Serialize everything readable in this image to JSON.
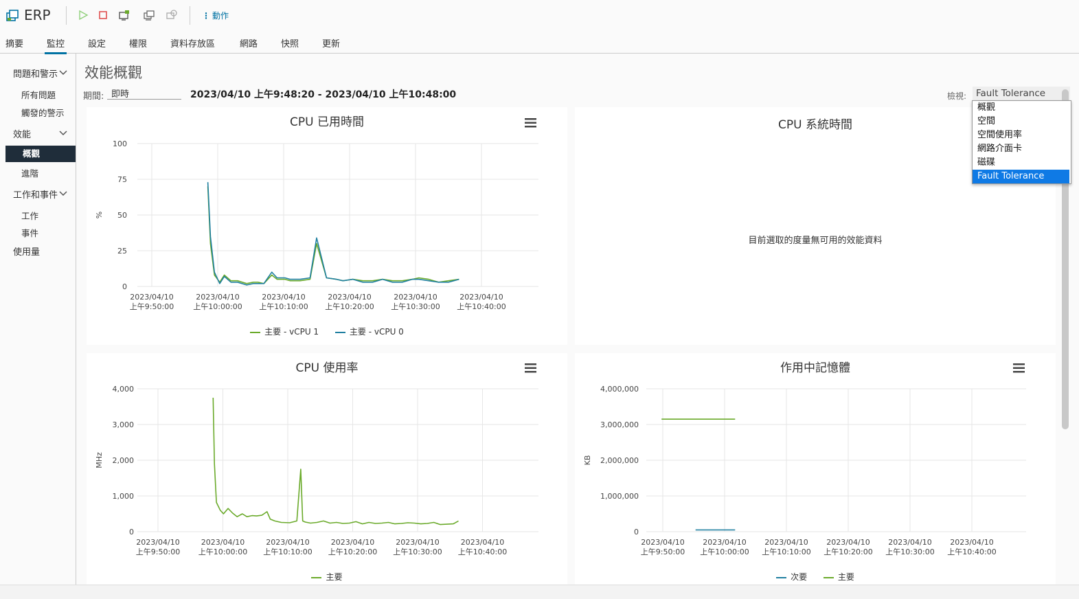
{
  "header": {
    "vm_name": "ERP",
    "actions_label": "動作",
    "toolbar_icons": [
      "power-on-icon",
      "power-off-icon",
      "console-icon",
      "migrate-icon",
      "snapshot-icon"
    ]
  },
  "tabs": [
    {
      "label": "摘要",
      "active": false
    },
    {
      "label": "監控",
      "active": true
    },
    {
      "label": "設定",
      "active": false
    },
    {
      "label": "權限",
      "active": false
    },
    {
      "label": "資料存放區",
      "active": false
    },
    {
      "label": "網路",
      "active": false
    },
    {
      "label": "快照",
      "active": false
    },
    {
      "label": "更新",
      "active": false
    }
  ],
  "sidebar": {
    "issues": {
      "label": "問題和警示",
      "items": [
        "所有問題",
        "觸發的警示"
      ]
    },
    "performance": {
      "label": "效能",
      "items": [
        "概觀",
        "進階"
      ],
      "active": "概觀"
    },
    "tasks": {
      "label": "工作和事件",
      "items": [
        "工作",
        "事件"
      ]
    },
    "usage": "使用量"
  },
  "main": {
    "title": "效能概觀",
    "period_label": "期間:",
    "period_value": "即時",
    "time_range": "2023/04/10 上午9:48:20 - 2023/04/10 上午10:48:00",
    "view_label": "檢視:",
    "view_selected": "Fault Tolerance",
    "view_options": [
      "概觀",
      "空間",
      "空間使用率",
      "網路介面卡",
      "磁碟",
      "Fault Tolerance"
    ]
  },
  "nodata_message": "目前選取的度量無可用的效能資料",
  "chart_data": [
    {
      "type": "line",
      "title": "CPU 已用時間",
      "ylabel": "%",
      "ylim": [
        0,
        100
      ],
      "yticks": [
        "100",
        "75",
        "50",
        "25",
        "0"
      ],
      "xticks": [
        "2023/04/10|上午9:50:00",
        "2023/04/10|上午10:00:00",
        "2023/04/10|上午10:10:00",
        "2023/04/10|上午10:20:00",
        "2023/04/10|上午10:30:00",
        "2023/04/10|上午10:40:00"
      ],
      "x_start_min": 50,
      "series": [
        {
          "name": "主要 - vCPU 1",
          "color": "#6aaa2a",
          "x": [
            58.5,
            58.9,
            59.5,
            60.3,
            61,
            62,
            63,
            64.4,
            65.4,
            66.1,
            67,
            68.2,
            69,
            70.2,
            71,
            72.5,
            74,
            75,
            76.5,
            78,
            79,
            80.5,
            82,
            83.5,
            85,
            86.5,
            88,
            89.5,
            90.5,
            92,
            93.5,
            95,
            96.6
          ],
          "y": [
            70,
            30,
            8,
            3,
            8,
            4,
            4,
            2,
            3,
            3,
            2,
            8,
            5,
            5,
            4,
            4,
            5,
            30,
            6,
            5,
            4,
            5,
            4,
            4,
            5,
            4,
            4,
            5,
            6,
            5,
            3,
            4,
            5
          ]
        },
        {
          "name": "主要 - vCPU 0",
          "color": "#1f7fa0",
          "x": [
            58.5,
            58.9,
            59.5,
            60.3,
            61,
            62,
            63,
            64.4,
            65.4,
            66.1,
            67,
            68.2,
            69,
            70.2,
            71,
            72.5,
            74,
            75,
            76.5,
            78,
            79,
            80.5,
            82,
            83.5,
            85,
            86.5,
            88,
            89.5,
            90.5,
            92,
            93.5,
            95,
            96.6
          ],
          "y": [
            73,
            35,
            10,
            2,
            7,
            3,
            3,
            1,
            2,
            2,
            2,
            10,
            6,
            6,
            5,
            5,
            6,
            34,
            6,
            5,
            4,
            5,
            3,
            3,
            5,
            3,
            3,
            5,
            5,
            4,
            3,
            3,
            5
          ]
        }
      ]
    },
    {
      "type": "line",
      "title": "CPU 系統時間",
      "series": []
    },
    {
      "type": "line",
      "title": "CPU 使用率",
      "ylabel": "MHz",
      "ylim": [
        0,
        4000
      ],
      "yticks": [
        "4,000",
        "3,000",
        "2,000",
        "1,000",
        "0"
      ],
      "xticks": [
        "2023/04/10|上午9:50:00",
        "2023/04/10|上午10:00:00",
        "2023/04/10|上午10:10:00",
        "2023/04/10|上午10:20:00",
        "2023/04/10|上午10:30:00",
        "2023/04/10|上午10:40:00"
      ],
      "x_start_min": 50,
      "series": [
        {
          "name": "主要",
          "color": "#6aaa2a",
          "x": [
            58.5,
            58.7,
            59,
            59.6,
            60.1,
            60.8,
            61.5,
            62.2,
            63,
            63.7,
            64.5,
            65.2,
            66,
            66.8,
            67.3,
            68,
            69,
            70.3,
            71.4,
            72,
            72.3,
            72.7,
            73.5,
            74.5,
            75.5,
            76.5,
            77.5,
            78.5,
            79.5,
            80.5,
            81.5,
            82.5,
            83.5,
            84.5,
            85.5,
            86.5,
            87.5,
            88.5,
            89.5,
            90.5,
            91.5,
            92.5,
            93.5,
            94.5,
            95.5,
            96.3
          ],
          "y": [
            3750,
            1900,
            820,
            600,
            500,
            650,
            520,
            420,
            500,
            420,
            450,
            440,
            460,
            560,
            350,
            300,
            260,
            250,
            300,
            1750,
            300,
            270,
            240,
            260,
            300,
            240,
            260,
            230,
            240,
            280,
            220,
            260,
            230,
            240,
            260,
            220,
            230,
            250,
            240,
            220,
            230,
            260,
            200,
            210,
            220,
            300
          ]
        }
      ]
    },
    {
      "type": "line",
      "title": "作用中記憶體",
      "ylabel": "KB",
      "ylim": [
        0,
        4000000
      ],
      "yticks": [
        "4,000,000",
        "3,000,000",
        "2,000,000",
        "1,000,000",
        "0"
      ],
      "xticks": [
        "2023/04/10|上午9:50:00",
        "2023/04/10|上午10:00:00",
        "2023/04/10|上午10:10:00",
        "2023/04/10|上午10:20:00",
        "2023/04/10|上午10:30:00",
        "2023/04/10|上午10:40:00"
      ],
      "x_start_min": 50,
      "series": [
        {
          "name": "次要",
          "color": "#1f7fa0",
          "x": [
            55.3,
            61.7
          ],
          "y": [
            50000,
            50000
          ]
        },
        {
          "name": "主要",
          "color": "#6aaa2a",
          "x": [
            49.8,
            61.7
          ],
          "y": [
            3150000,
            3150000
          ]
        }
      ]
    }
  ]
}
